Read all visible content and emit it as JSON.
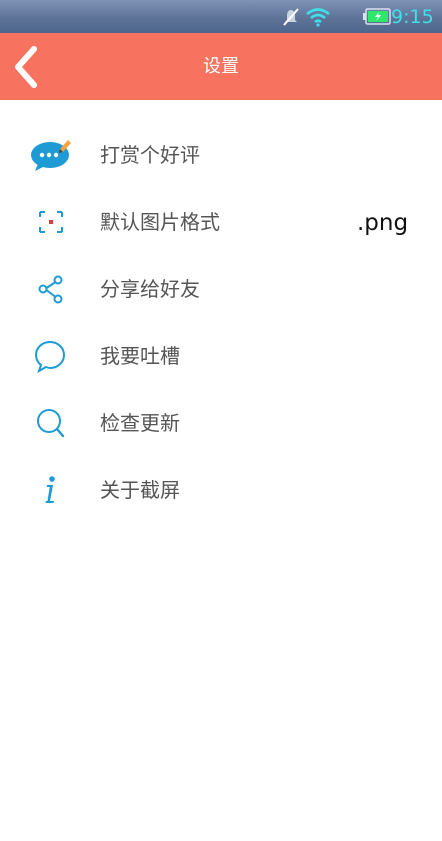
{
  "status_bar": {
    "time": "9:15",
    "icons": [
      "mute-icon",
      "wifi-icon",
      "battery-icon"
    ],
    "colors": {
      "time": "#3fe0e6",
      "battery": "#2ee86a"
    }
  },
  "header": {
    "title": "设置",
    "back_icon": "chevron-left-icon",
    "color": "#f7735f"
  },
  "menu": {
    "items": [
      {
        "label": "打赏个好评",
        "icon": "chat-bubble-pencil-icon"
      },
      {
        "label": "默认图片格式",
        "icon": "screenshot-frame-icon",
        "value": ".png"
      },
      {
        "label": "分享给好友",
        "icon": "share-icon"
      },
      {
        "label": "我要吐槽",
        "icon": "speech-bubble-icon"
      },
      {
        "label": "检查更新",
        "icon": "search-icon"
      },
      {
        "label": "关于截屏",
        "icon": "info-icon"
      }
    ],
    "icon_color": "#1e9bd4"
  }
}
